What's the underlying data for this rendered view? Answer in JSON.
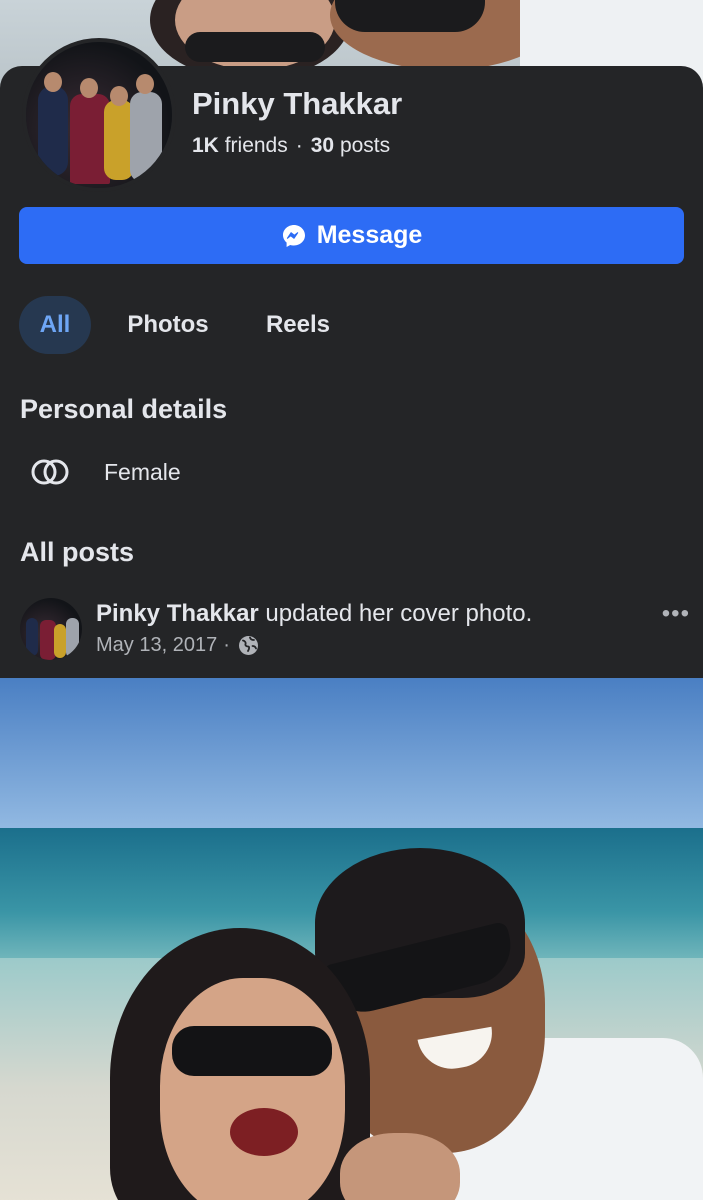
{
  "profile": {
    "name": "Pinky Thakkar",
    "friends_count": "1K",
    "friends_label": "friends",
    "separator": "·",
    "posts_count": "30",
    "posts_label": "posts"
  },
  "actions": {
    "message_label": "Message"
  },
  "tabs": [
    {
      "label": "All",
      "active": true
    },
    {
      "label": "Photos",
      "active": false
    },
    {
      "label": "Reels",
      "active": false
    }
  ],
  "personal_details": {
    "title": "Personal details",
    "gender": "Female",
    "gender_icon": "gender-rings-icon"
  },
  "posts": {
    "title": "All posts",
    "items": [
      {
        "author": "Pinky Thakkar",
        "action": "updated her cover photo.",
        "date": "May 13, 2017",
        "separator": "·",
        "privacy_icon": "globe-icon",
        "more_label": "•••"
      }
    ]
  },
  "colors": {
    "background": "#242527",
    "accent": "#2d6cf5",
    "active_tab_bg": "#263850",
    "active_tab_text": "#6ea6f5",
    "secondary_text": "#b0b3b8"
  }
}
